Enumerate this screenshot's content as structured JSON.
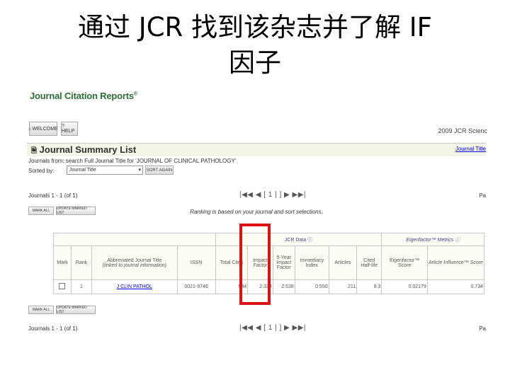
{
  "slide": {
    "title_line1": "通过 JCR 找到该杂志并了解  IF",
    "title_line2": "因子"
  },
  "jcr": {
    "logo": "Journal Citation Reports",
    "logo_mark": "®",
    "welcome_btn": "WELCOME",
    "help_btn": "? HELP",
    "edition": "2009 JCR Scienc",
    "summary_title": "Journal Summary List",
    "summary_link": "Journal Title",
    "journals_from": "Journals from: search Full Journal Title for 'JOURNAL OF CLINICAL PATHOLOGY'",
    "sorted_by_label": "Sorted by:",
    "sort_select_value": "Journal Title",
    "sort_again_btn": "SORT AGAIN",
    "pager_top_label": "Journals 1 - 1 (of 1)",
    "pager_top": "|◀◀ ◀ [ 1 | ] ▶ ▶▶|",
    "pa_top": "Pa",
    "mark_all_btn": "MARK ALL",
    "update_marked_btn": "UPDATE MARKED LIST",
    "ranking_note": "Ranking is based on your journal and sort selections.",
    "pager_bottom_label": "Journals 1 - 1 (of 1)",
    "pager_bottom": "|◀◀ ◀ [ 1 | ] ▶ ▶▶|",
    "pa_bottom": "Pa",
    "table": {
      "group_jcr": "JCR Data ⓘ",
      "group_eigen": "Eigenfactor™ Metrics ⓘ",
      "headers": {
        "mark": "Mark",
        "rank": "Rank",
        "abbrev_title": "Abbreviated Journal Title",
        "abbrev_sub": "(linked to journal information)",
        "issn": "ISSN",
        "total_cites": "Total Cites",
        "impact_factor": "Impact Factor",
        "five_year_if": "5-Year Impact Factor",
        "immediacy": "Immediacy Index",
        "articles": "Articles",
        "cited_half_life": "Cited Half-life",
        "eigenfactor": "Eigenfactor™ Score",
        "article_influence": "Article Influence™ Score"
      },
      "row": {
        "rank": "1",
        "title": "J CLIN PATHOL",
        "issn": "0021-9746",
        "total_cites": "944",
        "impact_factor": "2.339",
        "five_year_if": "2.538",
        "immediacy": "0.550",
        "articles": "211",
        "cited_half_life": "8.3",
        "eigenfactor": "0.02179",
        "article_influence": "0.734"
      }
    }
  },
  "colors": {
    "highlight": "#dd1111",
    "logo": "#2d6e34"
  }
}
